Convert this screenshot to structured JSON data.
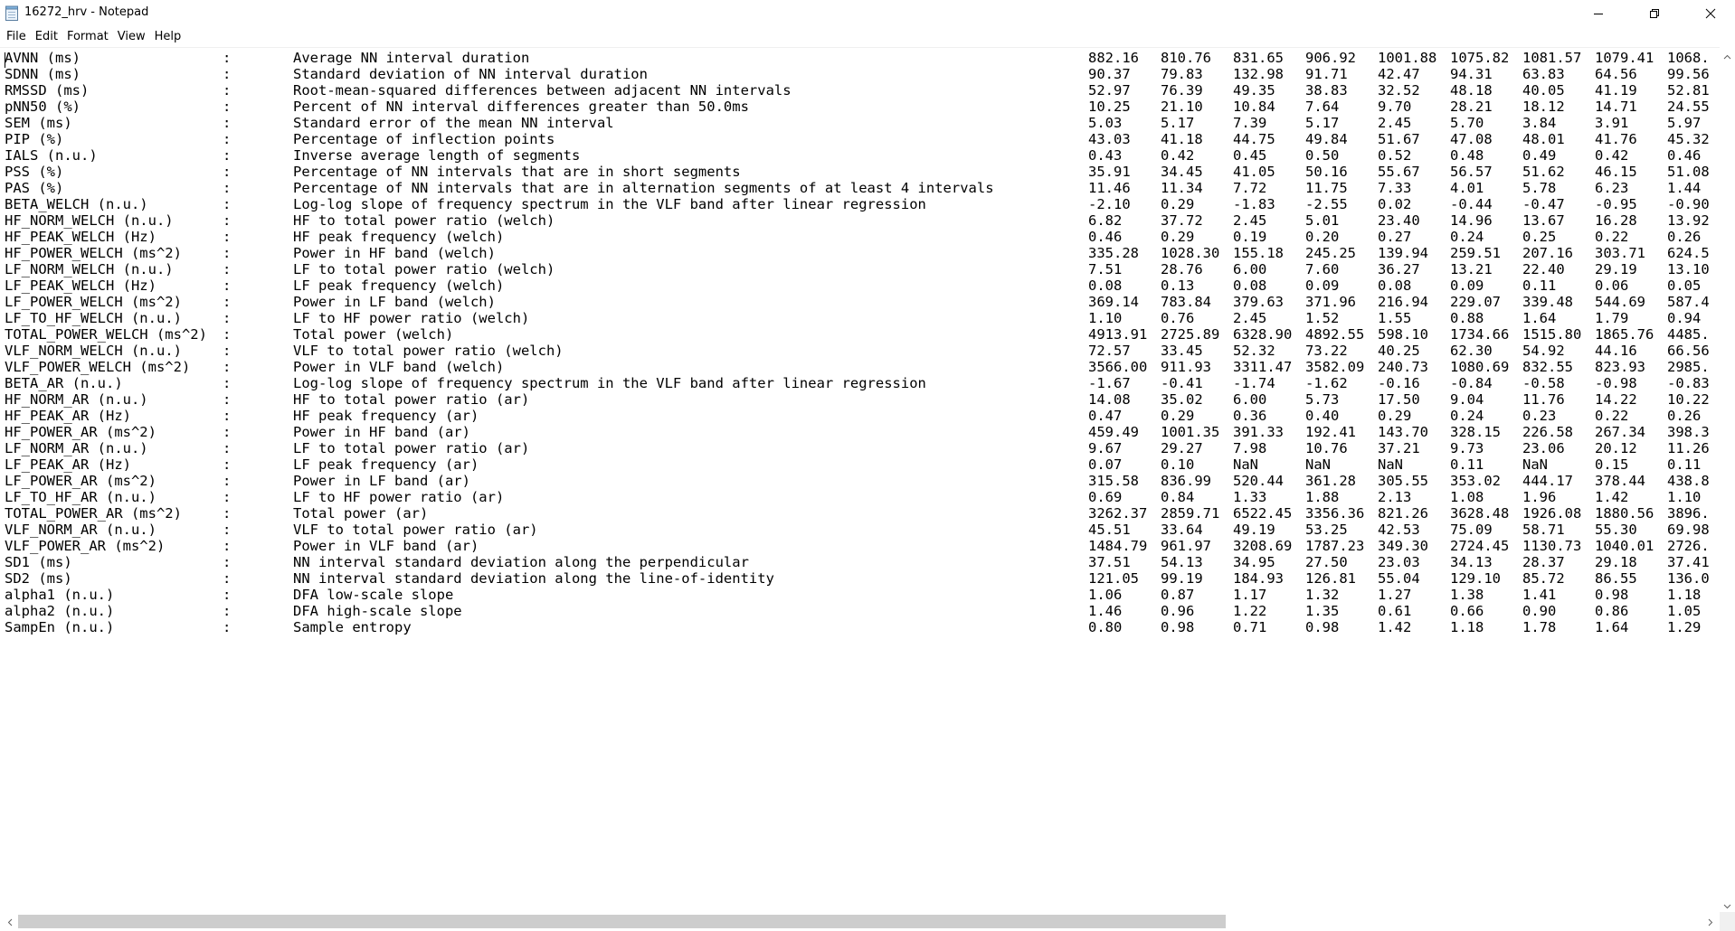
{
  "window": {
    "title": "16272_hrv - Notepad",
    "icon": "notepad-icon",
    "controls": [
      "minimize-icon",
      "maximize-icon",
      "close-icon"
    ]
  },
  "menu": [
    "File",
    "Edit",
    "Format",
    "View",
    "Help"
  ],
  "rows": [
    {
      "param": "AVNN (ms)",
      "desc": "Average NN interval duration",
      "values": [
        "882.16",
        "810.76",
        "831.65",
        "906.92",
        "1001.88",
        "1075.82",
        "1081.57",
        "1079.41",
        "1068."
      ]
    },
    {
      "param": "SDNN (ms)",
      "desc": "Standard deviation of NN interval duration",
      "values": [
        "90.37",
        "79.83",
        "132.98",
        "91.71",
        "42.47",
        "94.31",
        "63.83",
        "64.56",
        "99.56"
      ]
    },
    {
      "param": "RMSSD (ms)",
      "desc": "Root-mean-squared differences between adjacent NN intervals",
      "values": [
        "52.97",
        "76.39",
        "49.35",
        "38.83",
        "32.52",
        "48.18",
        "40.05",
        "41.19",
        "52.81"
      ]
    },
    {
      "param": "pNN50 (%)",
      "desc": "Percent of NN interval differences greater than 50.0ms",
      "values": [
        "10.25",
        "21.10",
        "10.84",
        "7.64",
        "9.70",
        "28.21",
        "18.12",
        "14.71",
        "24.55"
      ]
    },
    {
      "param": "SEM (ms)",
      "desc": "Standard error of the mean NN interval",
      "values": [
        "5.03",
        "5.17",
        "7.39",
        "5.17",
        "2.45",
        "5.70",
        "3.84",
        "3.91",
        "5.97"
      ]
    },
    {
      "param": "PIP (%)",
      "desc": "Percentage of inflection points",
      "values": [
        "43.03",
        "41.18",
        "44.75",
        "49.84",
        "51.67",
        "47.08",
        "48.01",
        "41.76",
        "45.32"
      ]
    },
    {
      "param": "IALS (n.u.)",
      "desc": "Inverse average length of segments",
      "values": [
        "0.43",
        "0.42",
        "0.45",
        "0.50",
        "0.52",
        "0.48",
        "0.49",
        "0.42",
        "0.46"
      ]
    },
    {
      "param": "PSS (%)",
      "desc": "Percentage of NN intervals that are in short segments",
      "values": [
        "35.91",
        "34.45",
        "41.05",
        "50.16",
        "55.67",
        "56.57",
        "51.62",
        "46.15",
        "51.08"
      ]
    },
    {
      "param": "PAS (%)",
      "desc": "Percentage of NN intervals that are in alternation segments of at least 4 intervals",
      "values": [
        "11.46",
        "11.34",
        "7.72",
        "11.75",
        "7.33",
        "4.01",
        "5.78",
        "6.23",
        "1.44"
      ]
    },
    {
      "param": "BETA_WELCH (n.u.)",
      "desc": "Log-log slope of frequency spectrum in the VLF band after linear regression",
      "values": [
        "-2.10",
        "0.29",
        "-1.83",
        "-2.55",
        "0.02",
        "-0.44",
        "-0.47",
        "-0.95",
        "-0.90"
      ]
    },
    {
      "param": "HF_NORM_WELCH (n.u.)",
      "desc": "HF to total power ratio (welch)",
      "values": [
        "6.82",
        "37.72",
        "2.45",
        "5.01",
        "23.40",
        "14.96",
        "13.67",
        "16.28",
        "13.92"
      ]
    },
    {
      "param": "HF_PEAK_WELCH (Hz)",
      "desc": "HF peak frequency (welch)",
      "values": [
        "0.46",
        "0.29",
        "0.19",
        "0.20",
        "0.27",
        "0.24",
        "0.25",
        "0.22",
        "0.26"
      ]
    },
    {
      "param": "HF_POWER_WELCH (ms^2)",
      "desc": "Power in HF band (welch)",
      "values": [
        "335.28",
        "1028.30",
        "155.18",
        "245.25",
        "139.94",
        "259.51",
        "207.16",
        "303.71",
        "624.5"
      ]
    },
    {
      "param": "LF_NORM_WELCH (n.u.)",
      "desc": "LF to total power ratio (welch)",
      "values": [
        "7.51",
        "28.76",
        "6.00",
        "7.60",
        "36.27",
        "13.21",
        "22.40",
        "29.19",
        "13.10"
      ]
    },
    {
      "param": "LF_PEAK_WELCH (Hz)",
      "desc": "LF peak frequency (welch)",
      "values": [
        "0.08",
        "0.13",
        "0.08",
        "0.09",
        "0.08",
        "0.09",
        "0.11",
        "0.06",
        "0.05"
      ]
    },
    {
      "param": "LF_POWER_WELCH (ms^2)",
      "desc": "Power in LF band (welch)",
      "values": [
        "369.14",
        "783.84",
        "379.63",
        "371.96",
        "216.94",
        "229.07",
        "339.48",
        "544.69",
        "587.4"
      ]
    },
    {
      "param": "LF_TO_HF_WELCH (n.u.)",
      "desc": "LF to HF power ratio (welch)",
      "values": [
        "1.10",
        "0.76",
        "2.45",
        "1.52",
        "1.55",
        "0.88",
        "1.64",
        "1.79",
        "0.94"
      ]
    },
    {
      "param": "TOTAL_POWER_WELCH (ms^2)",
      "desc": "Total power (welch)",
      "values": [
        "4913.91",
        "2725.89",
        "6328.90",
        "4892.55",
        "598.10",
        "1734.66",
        "1515.80",
        "1865.76",
        "4485."
      ]
    },
    {
      "param": "VLF_NORM_WELCH (n.u.)",
      "desc": "VLF to total power ratio (welch)",
      "values": [
        "72.57",
        "33.45",
        "52.32",
        "73.22",
        "40.25",
        "62.30",
        "54.92",
        "44.16",
        "66.56"
      ]
    },
    {
      "param": "VLF_POWER_WELCH (ms^2)",
      "desc": "Power in VLF band (welch)",
      "values": [
        "3566.00",
        "911.93",
        "3311.47",
        "3582.09",
        "240.73",
        "1080.69",
        "832.55",
        "823.93",
        "2985."
      ]
    },
    {
      "param": "BETA_AR (n.u.)",
      "desc": "Log-log slope of frequency spectrum in the VLF band after linear regression",
      "values": [
        "-1.67",
        "-0.41",
        "-1.74",
        "-1.62",
        "-0.16",
        "-0.84",
        "-0.58",
        "-0.98",
        "-0.83"
      ]
    },
    {
      "param": "HF_NORM_AR (n.u.)",
      "desc": "HF to total power ratio (ar)",
      "values": [
        "14.08",
        "35.02",
        "6.00",
        "5.73",
        "17.50",
        "9.04",
        "11.76",
        "14.22",
        "10.22"
      ]
    },
    {
      "param": "HF_PEAK_AR (Hz)",
      "desc": "HF peak frequency (ar)",
      "values": [
        "0.47",
        "0.29",
        "0.36",
        "0.40",
        "0.29",
        "0.24",
        "0.23",
        "0.22",
        "0.26"
      ]
    },
    {
      "param": "HF_POWER_AR (ms^2)",
      "desc": "Power in HF band (ar)",
      "values": [
        "459.49",
        "1001.35",
        "391.33",
        "192.41",
        "143.70",
        "328.15",
        "226.58",
        "267.34",
        "398.3"
      ]
    },
    {
      "param": "LF_NORM_AR (n.u.)",
      "desc": "LF to total power ratio (ar)",
      "values": [
        "9.67",
        "29.27",
        "7.98",
        "10.76",
        "37.21",
        "9.73",
        "23.06",
        "20.12",
        "11.26"
      ]
    },
    {
      "param": "LF_PEAK_AR (Hz)",
      "desc": "LF peak frequency (ar)",
      "values": [
        "0.07",
        "0.10",
        "NaN",
        "NaN",
        "NaN",
        "0.11",
        "NaN",
        "0.15",
        "0.11"
      ]
    },
    {
      "param": "LF_POWER_AR (ms^2)",
      "desc": "Power in LF band (ar)",
      "values": [
        "315.58",
        "836.99",
        "520.44",
        "361.28",
        "305.55",
        "353.02",
        "444.17",
        "378.44",
        "438.8"
      ]
    },
    {
      "param": "LF_TO_HF_AR (n.u.)",
      "desc": "LF to HF power ratio (ar)",
      "values": [
        "0.69",
        "0.84",
        "1.33",
        "1.88",
        "2.13",
        "1.08",
        "1.96",
        "1.42",
        "1.10"
      ]
    },
    {
      "param": "TOTAL_POWER_AR (ms^2)",
      "desc": "Total power (ar)",
      "values": [
        "3262.37",
        "2859.71",
        "6522.45",
        "3356.36",
        "821.26",
        "3628.48",
        "1926.08",
        "1880.56",
        "3896."
      ]
    },
    {
      "param": "VLF_NORM_AR (n.u.)",
      "desc": "VLF to total power ratio (ar)",
      "values": [
        "45.51",
        "33.64",
        "49.19",
        "53.25",
        "42.53",
        "75.09",
        "58.71",
        "55.30",
        "69.98"
      ]
    },
    {
      "param": "VLF_POWER_AR (ms^2)",
      "desc": "Power in VLF band (ar)",
      "values": [
        "1484.79",
        "961.97",
        "3208.69",
        "1787.23",
        "349.30",
        "2724.45",
        "1130.73",
        "1040.01",
        "2726."
      ]
    },
    {
      "param": "SD1 (ms)",
      "desc": "NN interval standard deviation along the perpendicular",
      "values": [
        "37.51",
        "54.13",
        "34.95",
        "27.50",
        "23.03",
        "34.13",
        "28.37",
        "29.18",
        "37.41"
      ]
    },
    {
      "param": "SD2 (ms)",
      "desc": "NN interval standard deviation along the line-of-identity",
      "values": [
        "121.05",
        "99.19",
        "184.93",
        "126.81",
        "55.04",
        "129.10",
        "85.72",
        "86.55",
        "136.0"
      ]
    },
    {
      "param": "alpha1 (n.u.)",
      "desc": "DFA low-scale slope",
      "values": [
        "1.06",
        "0.87",
        "1.17",
        "1.32",
        "1.27",
        "1.38",
        "1.41",
        "0.98",
        "1.18"
      ]
    },
    {
      "param": "alpha2 (n.u.)",
      "desc": "DFA high-scale slope",
      "values": [
        "1.46",
        "0.96",
        "1.22",
        "1.35",
        "0.61",
        "0.66",
        "0.90",
        "0.86",
        "1.05"
      ]
    },
    {
      "param": "SampEn (n.u.)",
      "desc": "Sample entropy",
      "values": [
        "0.80",
        "0.98",
        "0.71",
        "0.98",
        "1.42",
        "1.18",
        "1.78",
        "1.64",
        "1.29"
      ]
    }
  ],
  "scrollbars": {
    "vertical": {
      "up": "chevron-up-icon",
      "down": "chevron-down-icon"
    },
    "horizontal": {
      "left": "chevron-left-icon",
      "right": "chevron-right-icon",
      "position": 0
    }
  }
}
